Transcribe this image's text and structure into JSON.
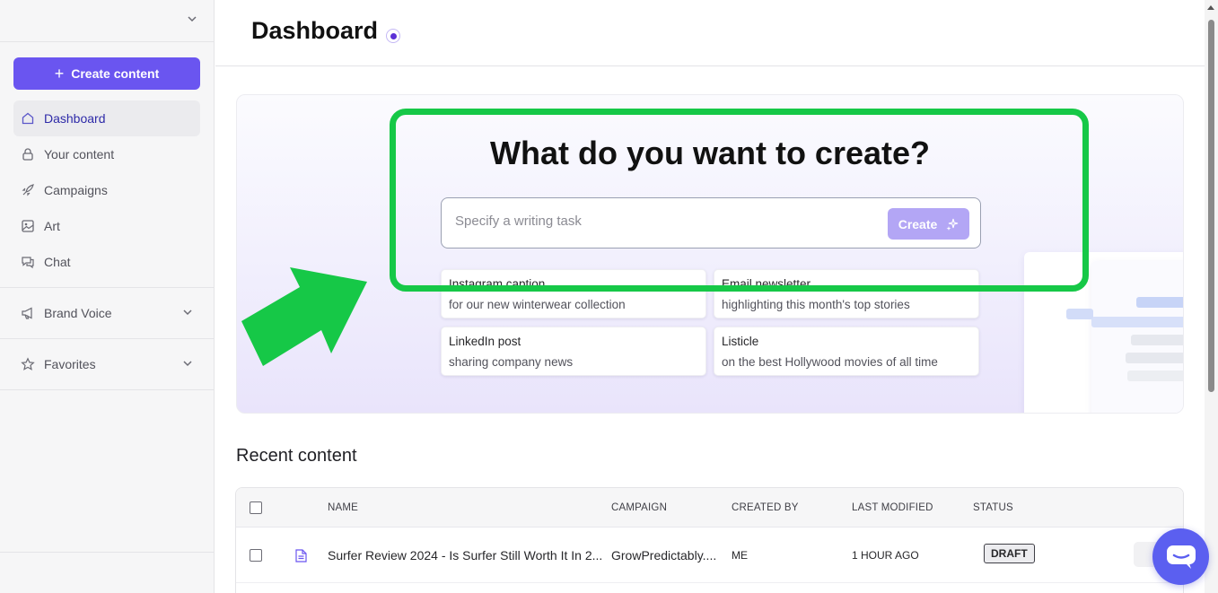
{
  "sidebar": {
    "create_button_label": "Create content",
    "nav": [
      {
        "label": "Dashboard",
        "icon": "home-icon",
        "active": true
      },
      {
        "label": "Your content",
        "icon": "lock-icon"
      },
      {
        "label": "Campaigns",
        "icon": "rocket-icon"
      },
      {
        "label": "Art",
        "icon": "image-icon"
      },
      {
        "label": "Chat",
        "icon": "chat-icon"
      }
    ],
    "brand_voice_label": "Brand Voice",
    "favorites_label": "Favorites"
  },
  "header": {
    "title": "Dashboard"
  },
  "hero": {
    "title": "What do you want to create?",
    "input_placeholder": "Specify a writing task",
    "create_button_label": "Create",
    "suggestions": [
      {
        "title": "Instagram caption",
        "subtitle": "for our new winterwear collection"
      },
      {
        "title": "Email newsletter",
        "subtitle": "highlighting this month's top stories"
      },
      {
        "title": "LinkedIn post",
        "subtitle": "sharing company news"
      },
      {
        "title": "Listicle",
        "subtitle": "on the best Hollywood movies of all time"
      }
    ]
  },
  "recent": {
    "title": "Recent content",
    "columns": {
      "name": "NAME",
      "campaign": "CAMPAIGN",
      "created_by": "CREATED BY",
      "last_modified": "LAST MODIFIED",
      "status": "STATUS"
    },
    "rows": [
      {
        "name": "Surfer Review 2024 - Is Surfer Still Worth It In 2...",
        "campaign": "GrowPredictably....",
        "created_by": "ME",
        "last_modified": "1 HOUR AGO",
        "status": "DRAFT"
      }
    ]
  },
  "colors": {
    "accent": "#6a55f0",
    "annotation": "#16c847"
  }
}
